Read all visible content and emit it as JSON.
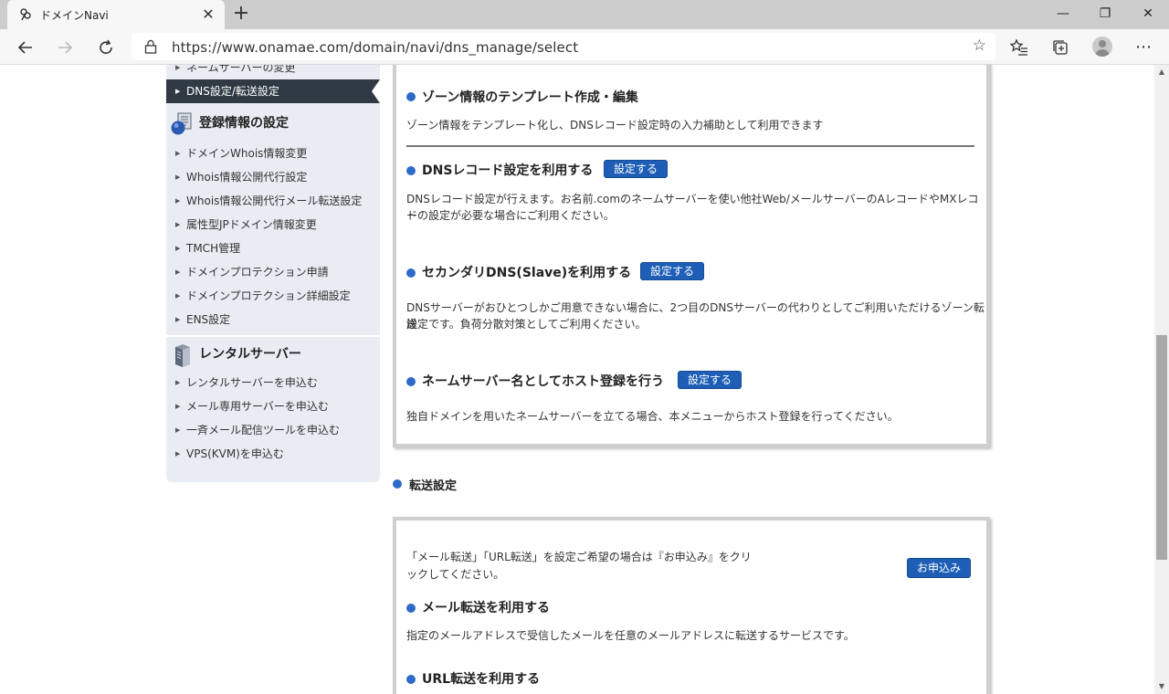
{
  "browser": {
    "tab_title": "ドメインNavi",
    "tab_close": "✕",
    "new_tab": "+",
    "url": "https://www.onamae.com/domain/navi/dns_manage/select",
    "window_controls": {
      "minimize": "—",
      "restore": "❐",
      "close": "✕"
    }
  },
  "sidebar": {
    "top_items": [
      {
        "label": "ネームサーバーの変更"
      },
      {
        "label": "DNS設定/転送設定",
        "active": true
      }
    ],
    "groups": [
      {
        "heading": "登録情報の設定",
        "icon": "registration-info-icon",
        "items": [
          "ドメインWhois情報変更",
          "Whois情報公開代行設定",
          "Whois情報公開代行メール転送設定",
          "属性型JPドメイン情報変更",
          "TMCH管理",
          "ドメインプロテクション申請",
          "ドメインプロテクション詳細設定",
          "ENS設定"
        ]
      },
      {
        "heading": "レンタルサーバー",
        "icon": "server-icon",
        "items": [
          "レンタルサーバーを申込む",
          "メール専用サーバーを申込む",
          "一斉メール配信ツールを申込む",
          "VPS(KVM)を申込む"
        ]
      }
    ]
  },
  "dns_panel": {
    "sections": [
      {
        "title": "ゾーン情報のテンプレート作成・編集",
        "description": "ゾーン情報をテンプレート化し、DNSレコード設定時の入力補助として利用できます"
      },
      {
        "title": "DNSレコード設定を利用する",
        "button": "設定する",
        "description_lines": [
          "DNSレコード設定が行えます。お名前.comのネームサーバーを使い他社Web/メールサーバーのAレコードやMXレコー",
          "ドの設定が必要な場合にご利用ください。"
        ]
      },
      {
        "title": "セカンダリDNS(Slave)を利用する",
        "button": "設定する",
        "description_lines": [
          "DNSサーバーがおひとつしかご用意できない場合に、2つ目のDNSサーバーの代わりとしてご利用いただけるゾーン転送",
          "設定です。負荷分散対策としてご利用ください。"
        ]
      },
      {
        "title": "ネームサーバー名としてホスト登録を行う",
        "button": "設定する",
        "description": "独自ドメインを用いたネームサーバーを立てる場合、本メニューからホスト登録を行ってください。"
      }
    ]
  },
  "transfer": {
    "heading": "転送設定",
    "intro_lines": [
      "「メール転送」「URL転送」を設定ご希望の場合は『お申込み』をクリ",
      "ックしてください。"
    ],
    "apply_button": "お申込み",
    "sections": [
      {
        "title": "メール転送を利用する",
        "description": "指定のメールアドレスで受信したメールを任意のメールアドレスに転送するサービスです。"
      },
      {
        "title": "URL転送を利用する"
      }
    ]
  },
  "colors": {
    "accent_blue": "#1e5eb6",
    "bullet_blue": "#2e6ac8",
    "sidebar_bg": "#e9ecf2",
    "sidebar_active": "#2f3a45"
  }
}
